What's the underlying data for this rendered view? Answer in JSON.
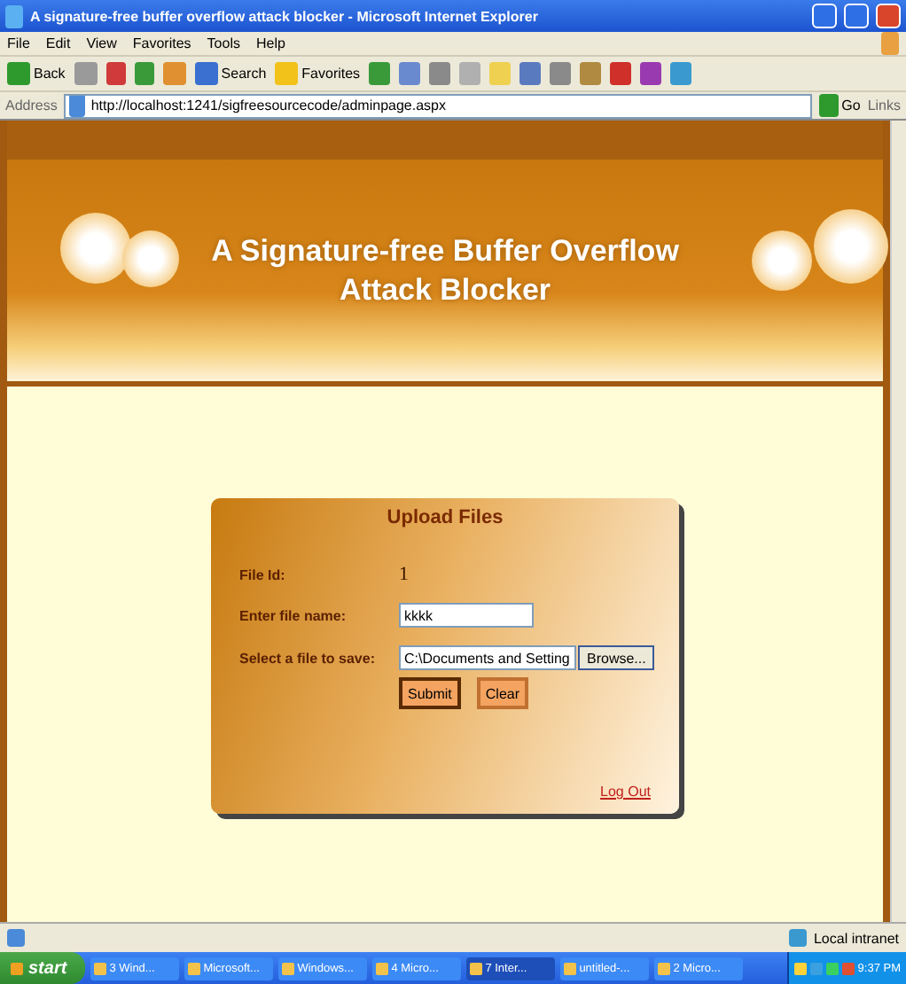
{
  "window": {
    "title": "A signature-free buffer overflow attack blocker - Microsoft Internet Explorer"
  },
  "menu": [
    "File",
    "Edit",
    "View",
    "Favorites",
    "Tools",
    "Help"
  ],
  "toolbar": [
    {
      "kind": "labeled",
      "label": "Back"
    },
    {
      "kind": "labeled",
      "label": "Search"
    },
    {
      "kind": "labeled",
      "label": "Favorites"
    }
  ],
  "address": {
    "label": "Address",
    "value": "http://localhost:1241/sigfreesourcecode/adminpage.aspx",
    "go": "Go",
    "links": "Links"
  },
  "banner": {
    "title_lines": [
      "A Signature-free Buffer Overflow",
      "Attack Blocker"
    ]
  },
  "upload": {
    "title": "Upload Files",
    "fields": [
      {
        "kind": "static",
        "label": "File Id:",
        "value": "1"
      },
      {
        "kind": "text",
        "label": "Enter file name:",
        "value": "kkkk"
      },
      {
        "kind": "file",
        "label": "Select a file to save:",
        "value": "C:\\Documents and Setting",
        "button": "Browse..."
      }
    ],
    "buttons": [
      {
        "label": "Submit",
        "focused": true
      },
      {
        "label": "Clear",
        "focused": false
      }
    ],
    "link": "Log Out"
  },
  "status_bar": {
    "zone": "Local intranet"
  },
  "taskbar": {
    "start": "start",
    "items": [
      {
        "label": "3 Wind...",
        "selected": false
      },
      {
        "label": "Microsoft...",
        "selected": false
      },
      {
        "label": "Windows...",
        "selected": false
      },
      {
        "label": "4 Micro...",
        "selected": false
      },
      {
        "label": "7 Inter...",
        "selected": true
      },
      {
        "label": "untitled-...",
        "selected": false
      },
      {
        "label": "2 Micro...",
        "selected": false
      }
    ],
    "clock": "9:37 PM"
  }
}
